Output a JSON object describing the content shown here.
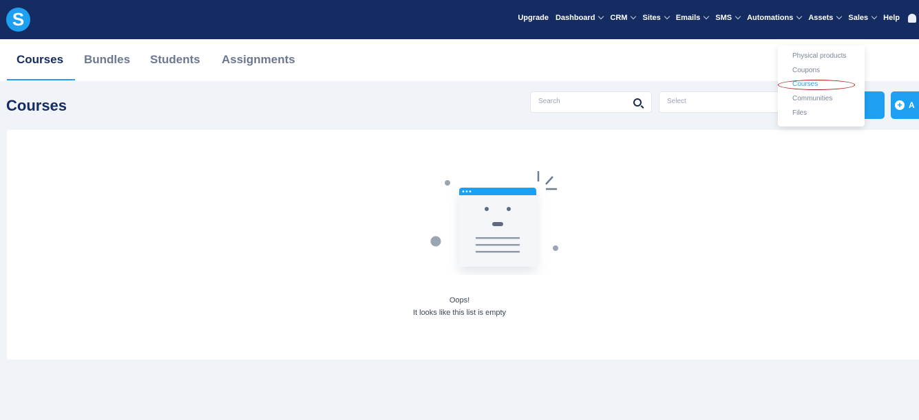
{
  "header": {
    "logo": "S",
    "nav": [
      {
        "label": "Upgrade",
        "dropdown": false
      },
      {
        "label": "Dashboard",
        "dropdown": true
      },
      {
        "label": "CRM",
        "dropdown": true
      },
      {
        "label": "Sites",
        "dropdown": true
      },
      {
        "label": "Emails",
        "dropdown": true
      },
      {
        "label": "SMS",
        "dropdown": true
      },
      {
        "label": "Automations",
        "dropdown": true
      },
      {
        "label": "Assets",
        "dropdown": true
      },
      {
        "label": "Sales",
        "dropdown": true
      },
      {
        "label": "Help",
        "dropdown": false
      }
    ]
  },
  "tabs": [
    {
      "label": "Courses",
      "active": true
    },
    {
      "label": "Bundles"
    },
    {
      "label": "Students"
    },
    {
      "label": "Assignments"
    }
  ],
  "page": {
    "title": "Courses",
    "search_placeholder": "Search",
    "select_placeholder": "Select",
    "add_button_label": "A"
  },
  "assets_menu": {
    "items": [
      "Physical products",
      "Coupons",
      "Courses",
      "Communities",
      "Files"
    ],
    "highlighted": "Courses"
  },
  "empty": {
    "title": "Oops!",
    "message": "It looks like this list is empty"
  },
  "colors": {
    "topbar": "#152c62",
    "accent": "#1ea0f2"
  }
}
